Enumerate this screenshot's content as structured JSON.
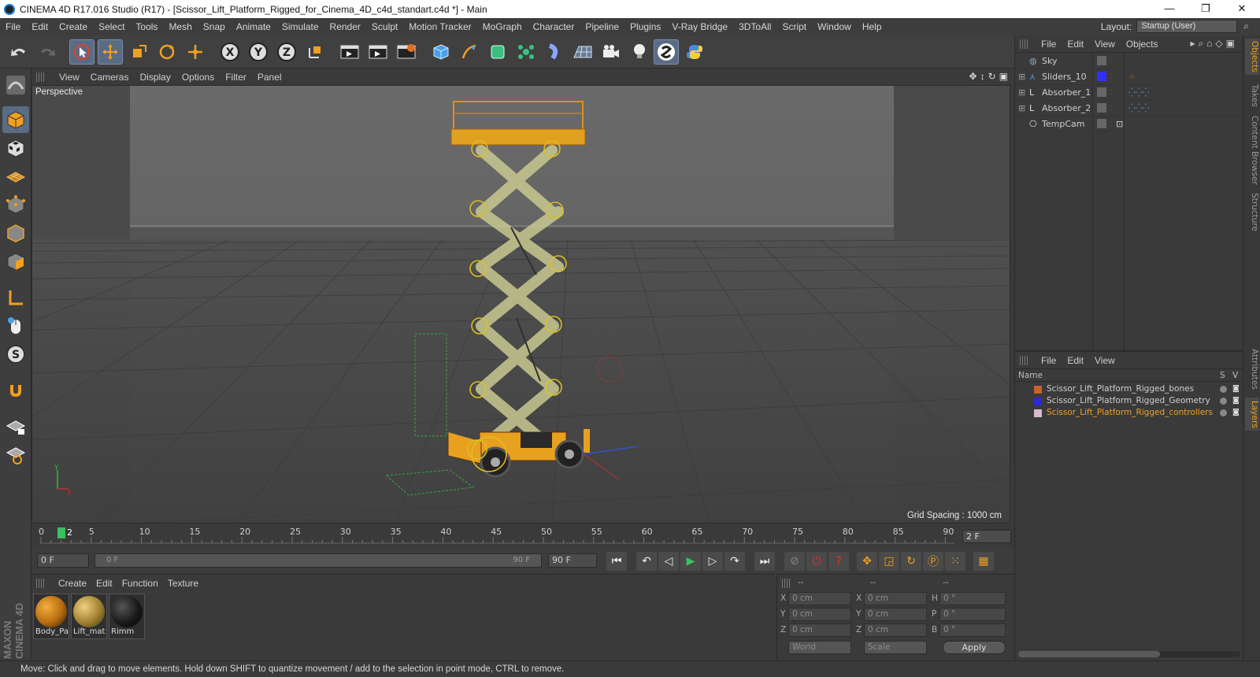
{
  "window": {
    "title": "CINEMA 4D R17.016 Studio (R17) - [Scissor_Lift_Platform_Rigged_for_Cinema_4D_c4d_standart.c4d *] - Main",
    "minimize": "—",
    "restore": "❐",
    "close": "✕"
  },
  "menu": {
    "items": [
      "File",
      "Edit",
      "Create",
      "Select",
      "Tools",
      "Mesh",
      "Snap",
      "Animate",
      "Simulate",
      "Render",
      "Sculpt",
      "Motion Tracker",
      "MoGraph",
      "Character",
      "Pipeline",
      "Plugins",
      "V-Ray Bridge",
      "3DToAll",
      "Script",
      "Window",
      "Help"
    ],
    "layout_label": "Layout:",
    "layout_value": "Startup (User)"
  },
  "viewport": {
    "menu": [
      "View",
      "Cameras",
      "Display",
      "Options",
      "Filter",
      "Panel"
    ],
    "camera_label": "Perspective",
    "grid_spacing": "Grid Spacing : 1000 cm",
    "nav_icons": [
      "move-view-icon",
      "dolly-icon",
      "rotate-view-icon",
      "maximize-icon"
    ]
  },
  "timeline": {
    "ticks": [
      "0",
      "5",
      "10",
      "15",
      "20",
      "25",
      "30",
      "35",
      "40",
      "45",
      "50",
      "55",
      "60",
      "65",
      "70",
      "75",
      "80",
      "85",
      "90"
    ],
    "current_frame_marker": "2",
    "current_frame": "2 F",
    "start_field": "0 F",
    "slider_left": "0 F",
    "slider_right": "90 F",
    "end_field": "90 F"
  },
  "materials": {
    "menu": [
      "Create",
      "Edit",
      "Function",
      "Texture"
    ],
    "items": [
      {
        "name": "Body_Pa",
        "color": "#d88a1a"
      },
      {
        "name": "Lift_mat",
        "color": "#c9a24a"
      },
      {
        "name": "Rimm",
        "color": "#1e1e1e"
      }
    ]
  },
  "coordinates": {
    "header": [
      "--",
      "--",
      "--"
    ],
    "rows": [
      {
        "a_label": "X",
        "a_val": "0 cm",
        "b_label": "X",
        "b_val": "0 cm",
        "c_label": "H",
        "c_val": "0 °"
      },
      {
        "a_label": "Y",
        "a_val": "0 cm",
        "b_label": "Y",
        "b_val": "0 cm",
        "c_label": "P",
        "c_val": "0 °"
      },
      {
        "a_label": "Z",
        "a_val": "0 cm",
        "b_label": "Z",
        "b_val": "0 cm",
        "c_label": "B",
        "c_val": "0 °"
      }
    ],
    "world": "World",
    "scale": "Scale",
    "apply": "Apply"
  },
  "objects": {
    "menu": [
      "File",
      "Edit",
      "View",
      "Objects"
    ],
    "rows": [
      {
        "name": "Sky",
        "color": ""
      },
      {
        "name": "Sliders_10",
        "color": "#3030ff"
      },
      {
        "name": "Absorber_1",
        "color": ""
      },
      {
        "name": "Absorber_2",
        "color": ""
      },
      {
        "name": "TempCam",
        "color": ""
      }
    ]
  },
  "layers": {
    "menu": [
      "File",
      "Edit",
      "View"
    ],
    "col_name": "Name",
    "col_s": "S",
    "col_v": "V",
    "rows": [
      {
        "name": "Scissor_Lift_Platform_Rigged_bones",
        "color": "#c8602a",
        "text_color": "#cfcfcf"
      },
      {
        "name": "Scissor_Lift_Platform_Rigged_Geometry",
        "color": "#2a2ad8",
        "text_color": "#cfcfcf"
      },
      {
        "name": "Scissor_Lift_Platform_Rigged_controllers",
        "color": "#d8b8d0",
        "text_color": "#f0a020"
      }
    ]
  },
  "side_tabs": [
    "Objects",
    "Takes",
    "Content Browser",
    "Structure",
    "Attributes",
    "Layers"
  ],
  "status": "Move: Click and drag to move elements. Hold down SHIFT to quantize movement / add to the selection in point mode, CTRL to remove.",
  "brand": "MAXON CINEMA 4D"
}
